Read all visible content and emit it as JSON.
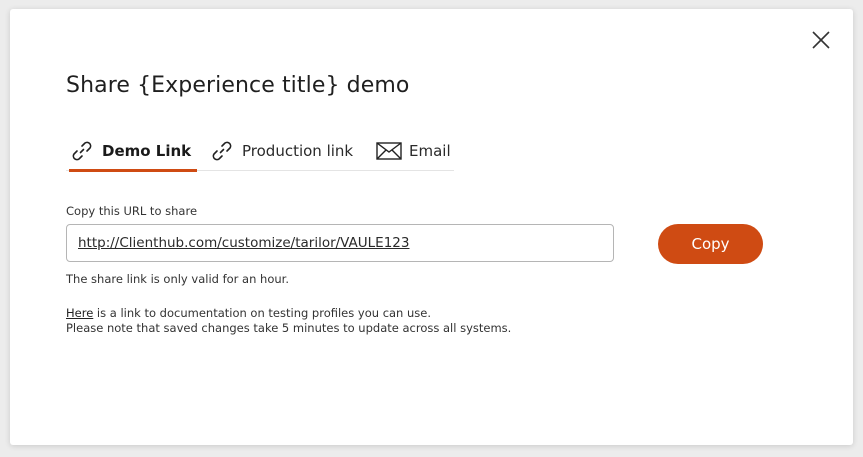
{
  "dialog": {
    "title": "Share {Experience title} demo",
    "close_icon": "close-icon"
  },
  "tabs": [
    {
      "label": "Demo Link",
      "icon": "link-icon",
      "active": true
    },
    {
      "label": "Production link",
      "icon": "link-icon",
      "active": false
    },
    {
      "label": "Email",
      "icon": "envelope-icon",
      "active": false
    }
  ],
  "share": {
    "url_label": "Copy this URL to share",
    "url_value": "http://Clienthub.com/customize/tarilor/VAULE123",
    "copy_label": "Copy",
    "validity_note": "The share link is only valid for an hour."
  },
  "docs": {
    "link_text": "Here",
    "link_suffix": " is a link to documentation on testing profiles you can use.",
    "update_note": "Please note that saved changes take 5 minutes to update across all systems."
  },
  "colors": {
    "accent": "#cf4b13"
  }
}
